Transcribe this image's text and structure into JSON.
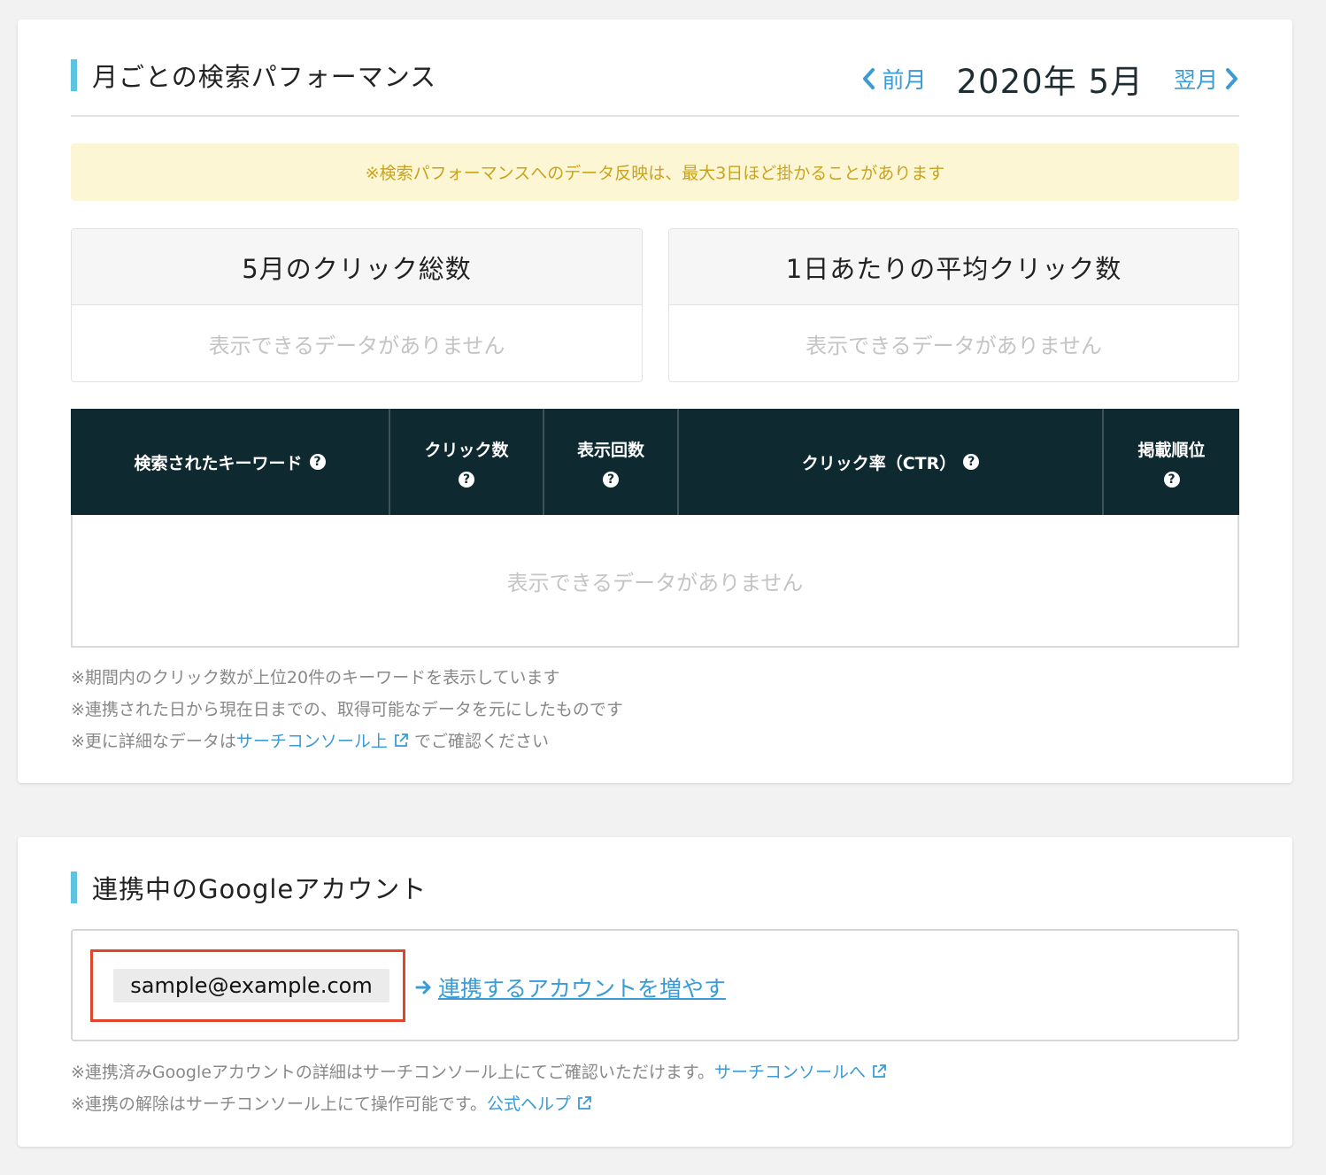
{
  "performance": {
    "title": "月ごとの検索パフォーマンス",
    "prev_label": "前月",
    "current_month": "2020年 5月",
    "next_label": "翌月",
    "notice": "※検索パフォーマンスへのデータ反映は、最大3日ほど掛かることがあります",
    "total_clicks": {
      "title": "5月のクリック総数",
      "empty": "表示できるデータがありません"
    },
    "avg_clicks": {
      "title": "1日あたりの平均クリック数",
      "empty": "表示できるデータがありません"
    },
    "table": {
      "col_keyword": "検索されたキーワード",
      "col_clicks": "クリック数",
      "col_impressions": "表示回数",
      "col_ctr": "クリック率（CTR）",
      "col_position": "掲載順位",
      "empty": "表示できるデータがありません"
    },
    "notes": {
      "line1": "※期間内のクリック数が上位20件のキーワードを表示しています",
      "line2": "※連携された日から現在日までの、取得可能なデータを元にしたものです",
      "line3_prefix": "※更に詳細なデータは",
      "line3_link": "サーチコンソール上",
      "line3_suffix": " でご確認ください"
    }
  },
  "accounts": {
    "title": "連携中のGoogleアカウント",
    "email": "sample@example.com",
    "add_link": "連携するアカウントを増やす",
    "notes": {
      "line1_prefix": "※連携済みGoogleアカウントの詳細はサーチコンソール上にてご確認いただけます。",
      "line1_link": "サーチコンソールへ",
      "line2_prefix": "※連携の解除はサーチコンソール上にて操作可能です。",
      "line2_link": "公式ヘルプ"
    }
  },
  "colors": {
    "accent_bar": "#5ec3df",
    "link": "#3a9bd5",
    "table_header_bg": "#0f2930",
    "notice_bg": "#fdf6d4",
    "notice_text": "#c9a31f",
    "highlight_border": "#e0442a"
  },
  "icons": {
    "prev": "chevron-left-icon",
    "next": "chevron-right-icon",
    "help": "question-circle-icon",
    "external": "external-link-icon",
    "arrow": "arrow-right-icon"
  }
}
